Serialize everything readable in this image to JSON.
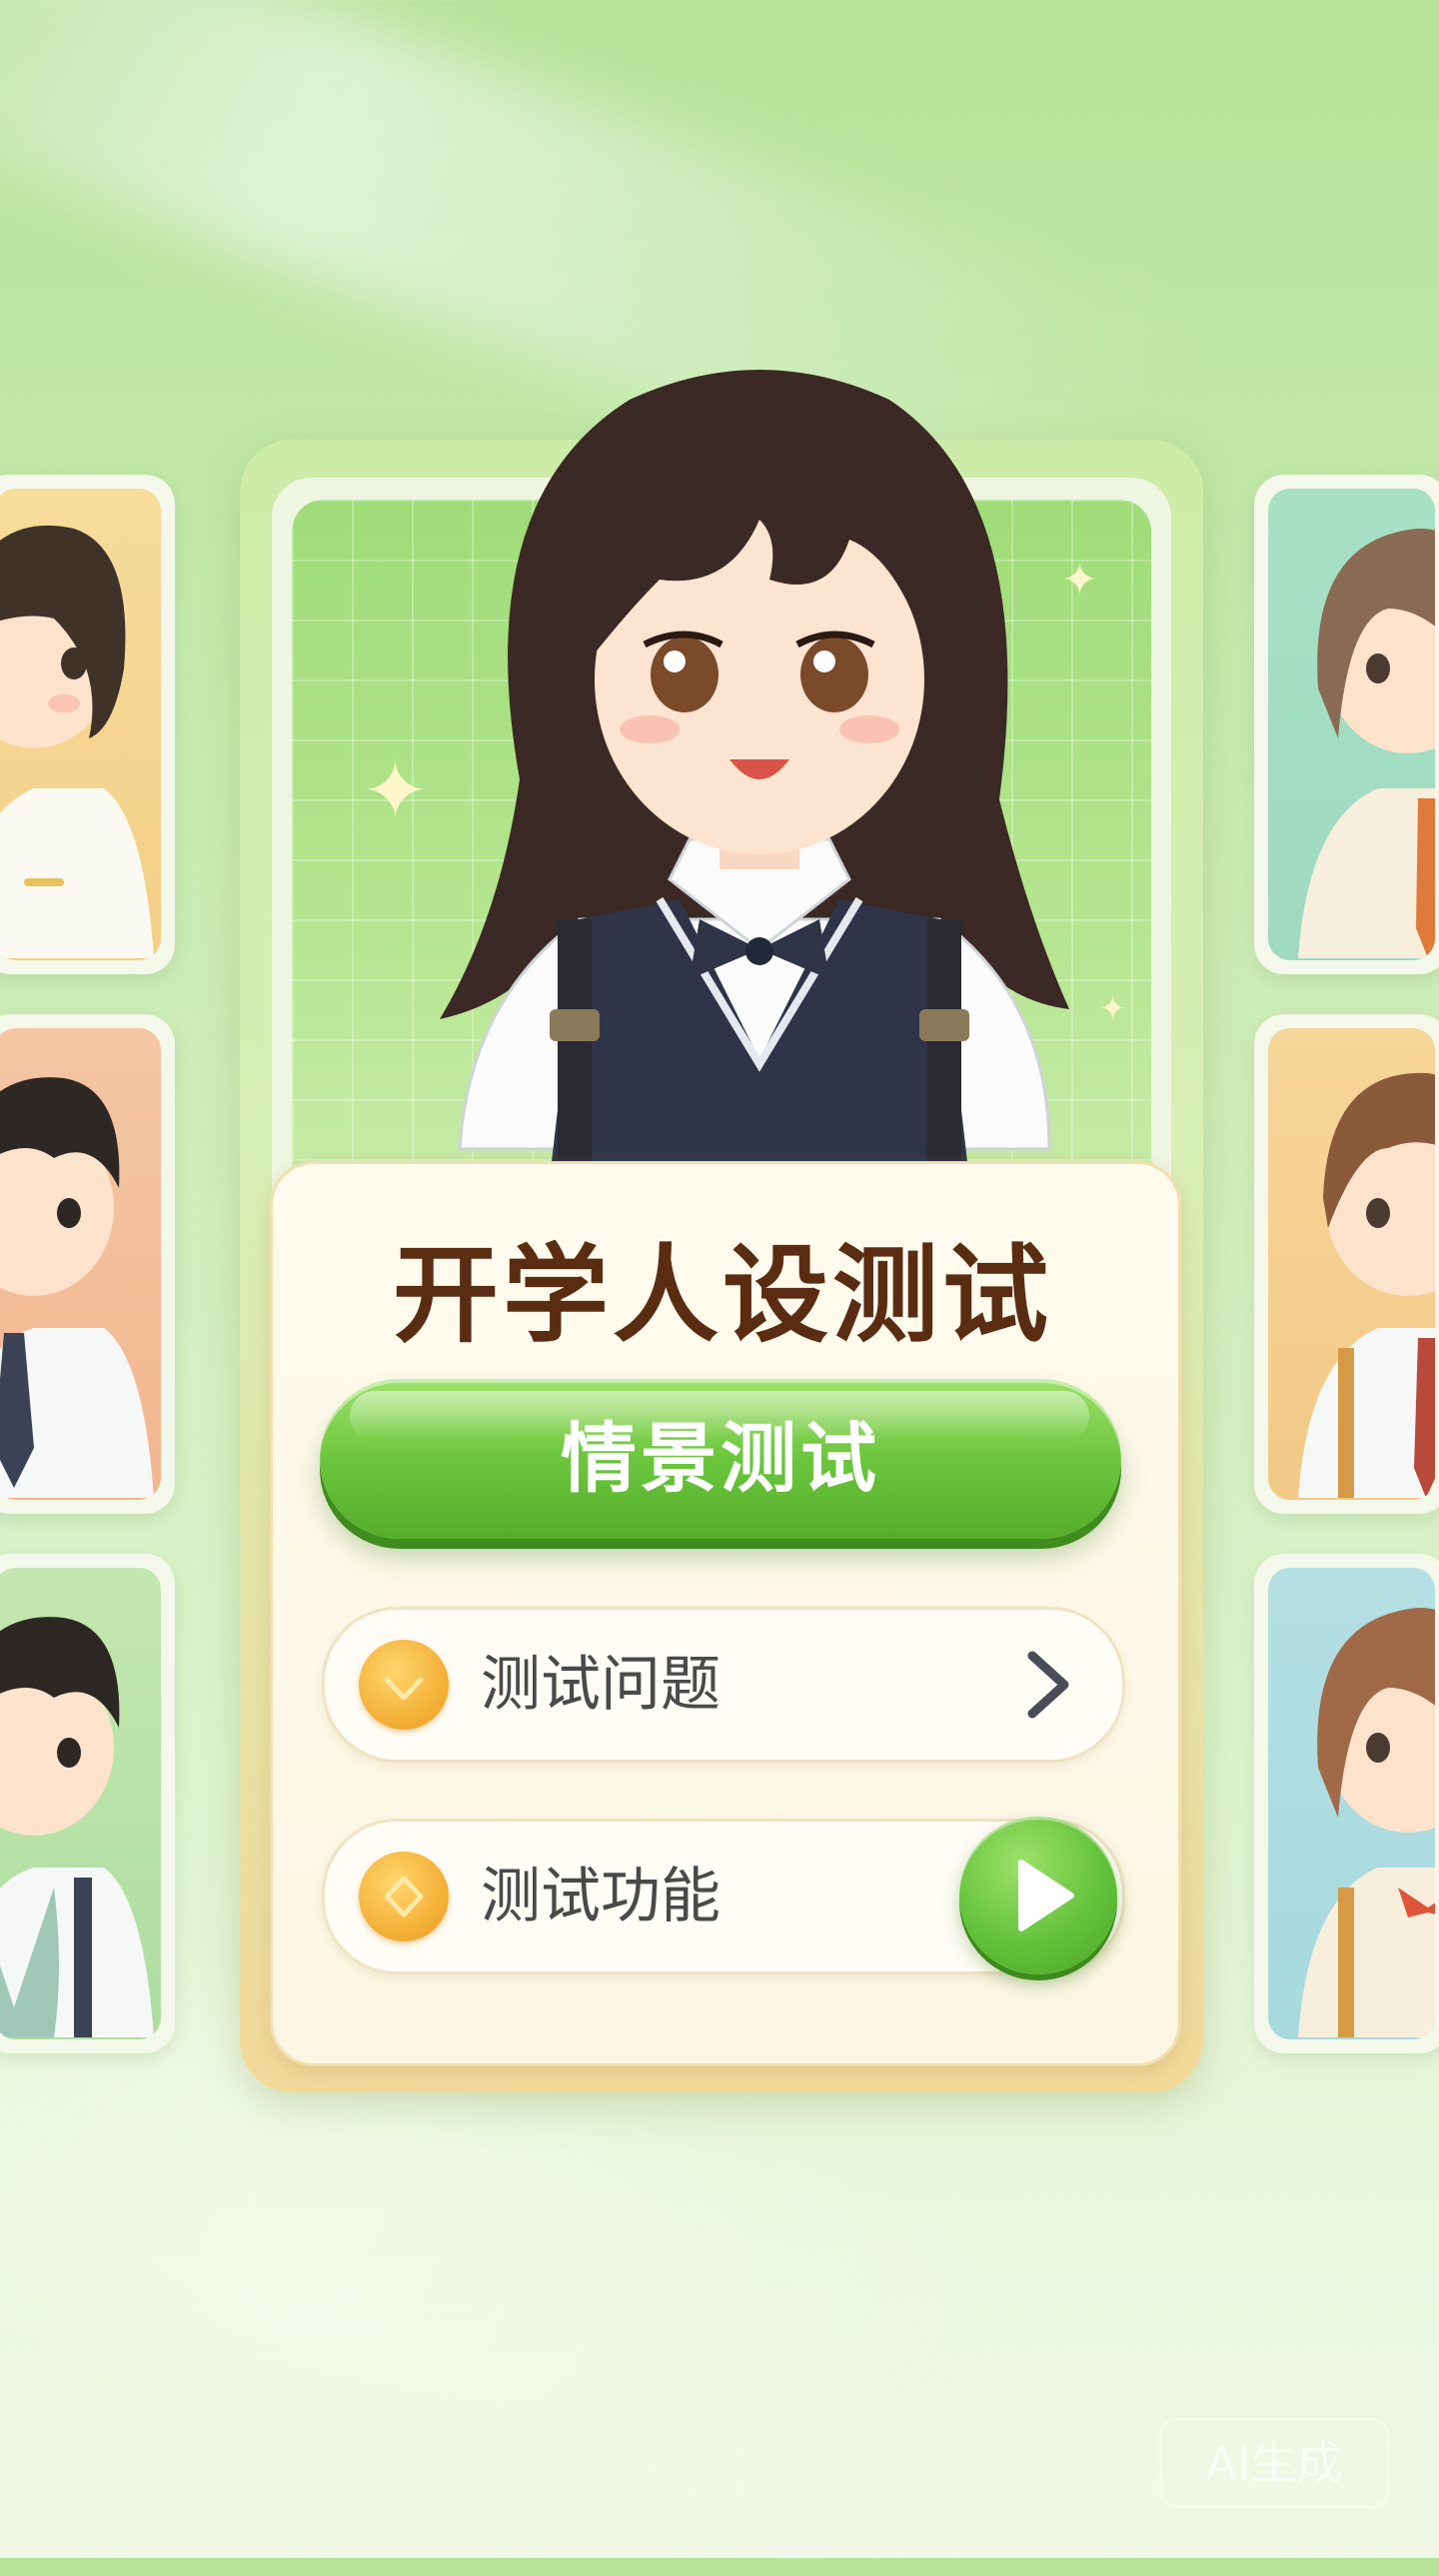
{
  "title": "开学人设测试",
  "primary_button": {
    "label": "情景测试"
  },
  "options": [
    {
      "label": "测试问题",
      "icon": "heart-icon",
      "trailing": "chevron-right-icon"
    },
    {
      "label": "测试功能",
      "icon": "diamond-icon",
      "trailing": "play-icon"
    }
  ],
  "side_characters": {
    "left": [
      "girl-short-hair-avatar",
      "boy-tie-avatar",
      "boy-vest-avatar"
    ],
    "right": [
      "girl-bob-avatar",
      "boy-backpack-avatar",
      "girl-bow-avatar"
    ]
  },
  "watermark": "AI生成",
  "colors": {
    "accent_green": "#6cc63d",
    "title_brown": "#5a2c12",
    "icon_orange": "#f4b23a"
  }
}
